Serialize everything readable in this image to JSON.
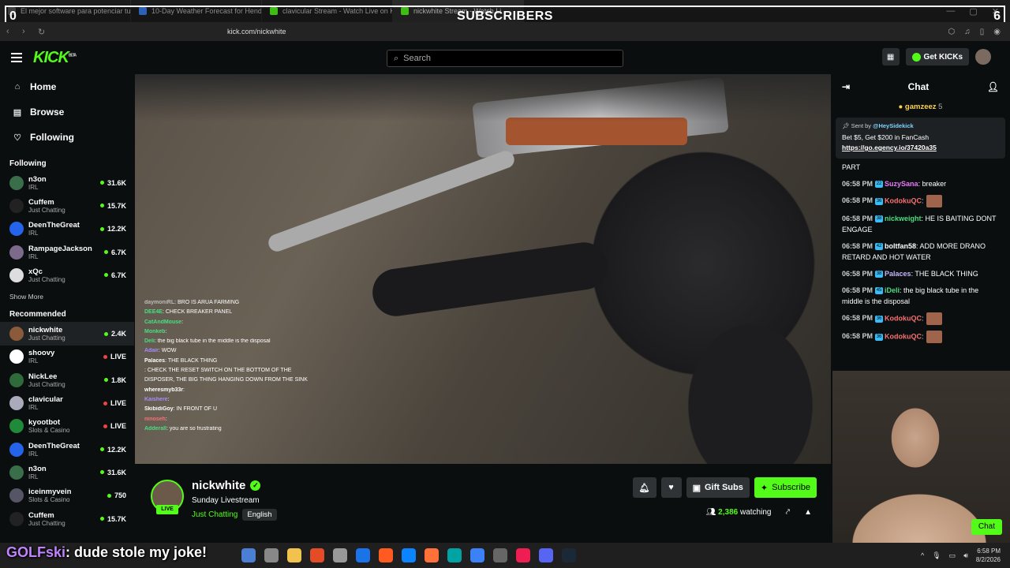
{
  "browser": {
    "tabs": [
      {
        "label": "El mejor software para potenciar tu s",
        "color": "#555"
      },
      {
        "label": "10-Day Weather Forecast for Hender",
        "color": "#3b82f6"
      },
      {
        "label": "clavicular Stream - Watch Live on Ki",
        "color": "#53fc18"
      },
      {
        "label": "nickwhite Stream - Watch Li",
        "color": "#53fc18"
      }
    ],
    "url": "kick.com/nickwhite"
  },
  "overlay": {
    "title": "SUBSCRIBERS",
    "left_num": "0",
    "right_num": "6"
  },
  "header": {
    "logo": "KICK",
    "logo_tag": "BETA",
    "search_placeholder": "Search",
    "get_kicks": "Get KICKs"
  },
  "sidebar": {
    "nav": [
      {
        "label": "Home",
        "icon": "home-icon",
        "glyph": "⌂"
      },
      {
        "label": "Browse",
        "icon": "browse-icon",
        "glyph": "▤"
      },
      {
        "label": "Following",
        "icon": "heart-icon",
        "glyph": "♡"
      }
    ],
    "following_title": "Following",
    "following": [
      {
        "name": "n3on",
        "cat": "IRL",
        "viewers": "31.6K",
        "color": "#3a6e4a"
      },
      {
        "name": "Cuffem",
        "cat": "Just Chatting",
        "viewers": "15.7K",
        "color": "#222"
      },
      {
        "name": "DeenTheGreat",
        "cat": "IRL",
        "viewers": "12.2K",
        "color": "#2563eb"
      },
      {
        "name": "RampageJackson",
        "cat": "IRL",
        "viewers": "6.7K",
        "color": "#7c6a8a"
      },
      {
        "name": "xQc",
        "cat": "Just Chatting",
        "viewers": "6.7K",
        "color": "#ddd"
      }
    ],
    "show_more": "Show More",
    "recommended_title": "Recommended",
    "recommended": [
      {
        "name": "nickwhite",
        "cat": "Just Chatting",
        "viewers": "2.4K",
        "color": "#8a5a3a"
      },
      {
        "name": "shoovy",
        "cat": "IRL",
        "viewers": "LIVE",
        "color": "#fff"
      },
      {
        "name": "NickLee",
        "cat": "Just Chatting",
        "viewers": "1.8K",
        "color": "#2f6a3a"
      },
      {
        "name": "clavicular",
        "cat": "IRL",
        "viewers": "LIVE",
        "color": "#aab"
      },
      {
        "name": "kyootbot",
        "cat": "Slots & Casino",
        "viewers": "LIVE",
        "color": "#1f8a3a"
      },
      {
        "name": "DeenTheGreat",
        "cat": "IRL",
        "viewers": "12.2K",
        "color": "#2563eb"
      },
      {
        "name": "n3on",
        "cat": "IRL",
        "viewers": "31.6K",
        "color": "#3a6e4a"
      },
      {
        "name": "iceinmyvein",
        "cat": "Slots & Casino",
        "viewers": "750",
        "color": "#556"
      },
      {
        "name": "Cuffem",
        "cat": "Just Chatting",
        "viewers": "15.7K",
        "color": "#222"
      }
    ]
  },
  "video_chat": [
    {
      "u": "daymoniRL",
      "t": ": BRO IS ARUA FARMING",
      "c": "#bbb"
    },
    {
      "u": "DEE4E",
      "t": ": CHECK BREAKER PANEL",
      "c": "#4ade80"
    },
    {
      "u": "CatAndMouse",
      "t": ":",
      "c": "#4ade80"
    },
    {
      "u": "Monkeb",
      "t": ":",
      "c": "#4ade80"
    },
    {
      "u": "Deli",
      "t": ": the big black tube in the middle is the disposal",
      "c": "#4ade80"
    },
    {
      "u": "Adair",
      "t": ": WOW",
      "c": "#a78bfa"
    },
    {
      "u": "Palaces",
      "t": ": THE BLACK THING",
      "c": "#fff"
    },
    {
      "u": "",
      "t": ": CHECK THE RESET SWITCH ON THE BOTTOM OF THE",
      "c": "#4ade80"
    },
    {
      "u": "",
      "t": "DISPOSER, THE BIG THING HANGING DOWN FROM THE SINK",
      "c": "#fff"
    },
    {
      "u": "wheresmyb33r",
      "t": ":",
      "c": "#fff"
    },
    {
      "u": "Kaishere",
      "t": ":",
      "c": "#a78bfa"
    },
    {
      "u": "SkibidiGoy",
      "t": ": IN FRONT OF U",
      "c": "#fff"
    },
    {
      "u": "ninoseh",
      "t": ":",
      "c": "#f87171"
    },
    {
      "u": "Adderall",
      "t": ": you are so frustrating",
      "c": "#4ade80"
    }
  ],
  "stream": {
    "name": "nickwhite",
    "title": "Sunday Livestream",
    "category": "Just Chatting",
    "language": "English",
    "live": "LIVE",
    "watching": "2,386",
    "watching_label": "watching",
    "gift": "Gift Subs",
    "subscribe": "Subscribe"
  },
  "chat": {
    "title": "Chat",
    "pinned_user": "gamzeez",
    "pinned_count": "5",
    "pin_sent_by": "Sent by",
    "pin_sender": "@HeySidekick",
    "pin_text": "Bet $5, Get $200 in FanCash",
    "pin_link": "https://go.egency.io/37420a35",
    "partial": "PART",
    "messages": [
      {
        "time": "06:58 PM",
        "badge": "22",
        "user": "SuzySana",
        "ucolor": "#e879f9",
        "text": ": breaker"
      },
      {
        "time": "06:58 PM",
        "badge": "36",
        "user": "KodokuQC",
        "ucolor": "#f87171",
        "text": ":",
        "emote": true
      },
      {
        "time": "06:58 PM",
        "badge": "38",
        "user": "nickweight",
        "ucolor": "#4ade80",
        "text": ": HE IS BAITING DONT ENGAGE"
      },
      {
        "time": "06:58 PM",
        "badge": "42",
        "user": "boltfan58",
        "ucolor": "#fff",
        "text": ": ADD MORE DRANO RETARD AND HOT WATER"
      },
      {
        "time": "06:58 PM",
        "badge": "38",
        "user": "Palaces",
        "ucolor": "#c4b5fd",
        "text": ": THE BLACK THING"
      },
      {
        "time": "06:58 PM",
        "badge": "45",
        "user": "iDeli",
        "ucolor": "#4ade80",
        "text": ": the big black tube in the middle is the disposal"
      },
      {
        "time": "06:58 PM",
        "badge": "36",
        "user": "KodokuQC",
        "ucolor": "#f87171",
        "text": ":",
        "emote": true
      },
      {
        "time": "06:58 PM",
        "badge": "36",
        "user": "KodokuQC",
        "ucolor": "#f87171",
        "text": ":",
        "emote": true
      }
    ],
    "send": "Chat"
  },
  "ticker": {
    "user": "GOLFski",
    "text": ": dude stole my joke!"
  },
  "taskbar": {
    "icons": [
      "#4a7fd4",
      "#888",
      "#f2c14e",
      "#e34c26",
      "#999",
      "#1a73e8",
      "#ff5a1f",
      "#0a84ff",
      "#ff7139",
      "#00a3a3",
      "#3b82f6",
      "#666",
      "#ee1d52",
      "#5865f2",
      "#1b2838"
    ],
    "time": "6:58 PM",
    "date": "8/2/2026"
  }
}
